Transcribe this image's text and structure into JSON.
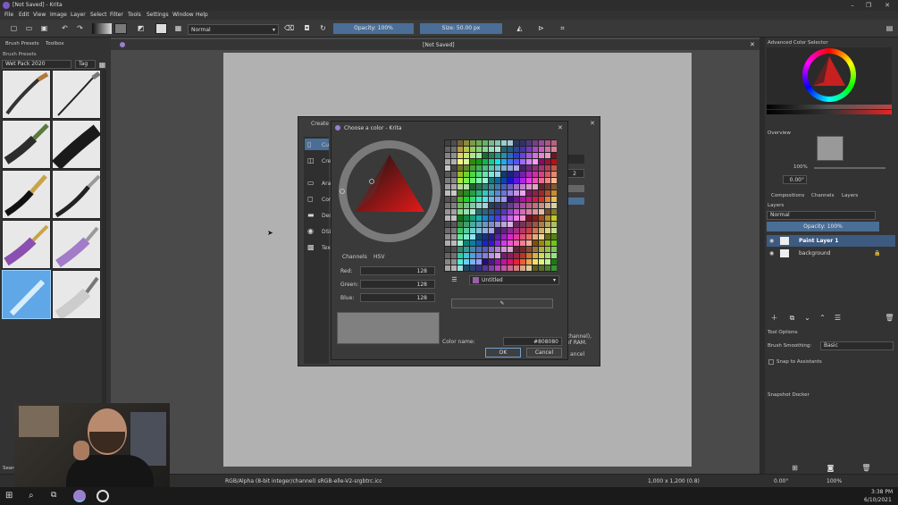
{
  "window": {
    "title": "[Not Saved] - Krita",
    "doc_title": "[Not Saved]"
  },
  "menu": [
    "File",
    "Edit",
    "View",
    "Image",
    "Layer",
    "Select",
    "Filter",
    "Tools",
    "Settings",
    "Window",
    "Help"
  ],
  "toolbar": {
    "blend_mode": "Normal",
    "opacity": "Opacity: 100%",
    "size": "Size: 50.00 px"
  },
  "left": {
    "tab1": "Brush Presets",
    "tab2": "Toolbox",
    "panel_title": "Brush Presets",
    "preset_bundle": "Wet Pack 2020",
    "tag": "Tag",
    "search": "Search"
  },
  "create_dialog": {
    "title": "Create n",
    "items": [
      "Cu",
      "Cre",
      "Ara",
      "Com",
      "Des",
      "DSL",
      "Tex"
    ],
    "value": "2",
    "note1": "channel),",
    "note2": "of RAM.",
    "cancel": "ancel"
  },
  "color_dialog": {
    "title": "Choose a color - Krita",
    "tab_channels": "Channels",
    "tab_hsv": "HSV",
    "red_label": "Red:",
    "red": "128",
    "green_label": "Green:",
    "green": "128",
    "blue_label": "Blue:",
    "blue": "128",
    "palette": "Untitled",
    "color_name_label": "Color name:",
    "color_name": "#808080",
    "ok": "OK",
    "cancel": "Cancel",
    "current_color": "#808080"
  },
  "right": {
    "color_selector": "Advanced Color Selector",
    "overview": "Overview",
    "zoom": "100%",
    "rotation": "0.00°",
    "tabs": [
      "Compositions",
      "Channels",
      "Layers"
    ],
    "layers_title": "Layers",
    "layer_blend": "Normal",
    "layer_opacity": "Opacity: 100%",
    "layers": [
      "Paint Layer 1",
      "background"
    ],
    "tool_options": "Tool Options",
    "brush_smoothing_label": "Brush Smoothing:",
    "brush_smoothing": "Basic",
    "snap": "Snap to Assistants",
    "snapshot": "Snapshot Docker"
  },
  "status": {
    "color_space": "RGB/Alpha (8-bit integer/channel)  sRGB-elle-V2-srgbtrc.icc",
    "dims": "1,000 x 1,200 (0.8)",
    "rotation": "0.00°",
    "zoom": "100%"
  },
  "taskbar": {
    "time": "3:38 PM",
    "date": "6/10/2021"
  },
  "colors": {
    "accent": "#4a6e96",
    "selected_layer": "#3d5a80"
  }
}
